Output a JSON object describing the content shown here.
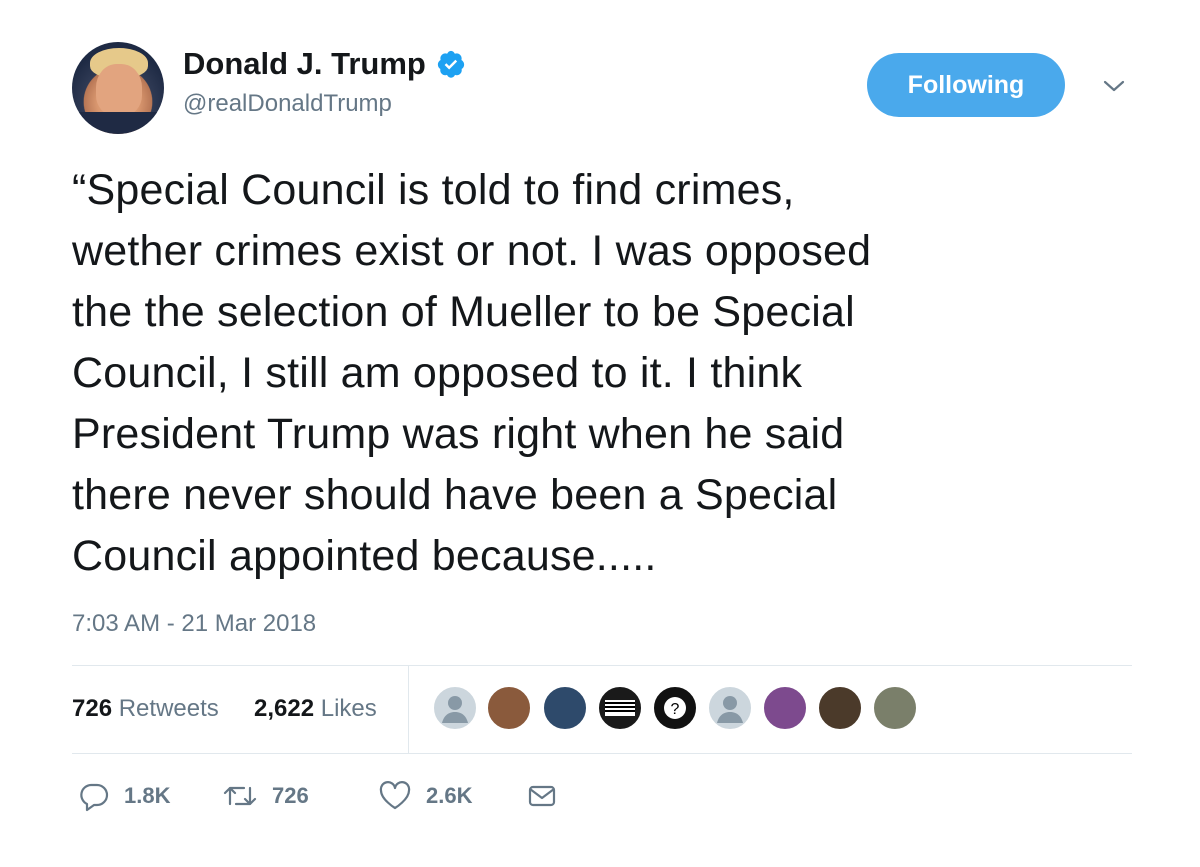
{
  "user": {
    "display_name": "Donald J. Trump",
    "handle": "@realDonaldTrump",
    "verified_icon": "verified-badge-icon"
  },
  "follow_button": {
    "label": "Following"
  },
  "tweet": {
    "lines": [
      "“Special Council is told to find crimes,",
      "wether crimes exist or not. I was opposed",
      "the the selection of Mueller to be Special",
      "Council, I still am opposed to it. I think",
      "President Trump was right when he said",
      "there never should have been a Special",
      "Council appointed because....."
    ],
    "timestamp": "7:03 AM - 21 Mar 2018"
  },
  "stats": {
    "retweets_count": "726",
    "retweets_label": "Retweets",
    "likes_count": "2,622",
    "likes_label": "Likes"
  },
  "actions": {
    "replies": "1.8K",
    "retweets": "726",
    "likes": "2.6K"
  },
  "colors": {
    "accent": "#4aa9ec",
    "secondary_text": "#657786",
    "primary_text": "#14171a"
  }
}
